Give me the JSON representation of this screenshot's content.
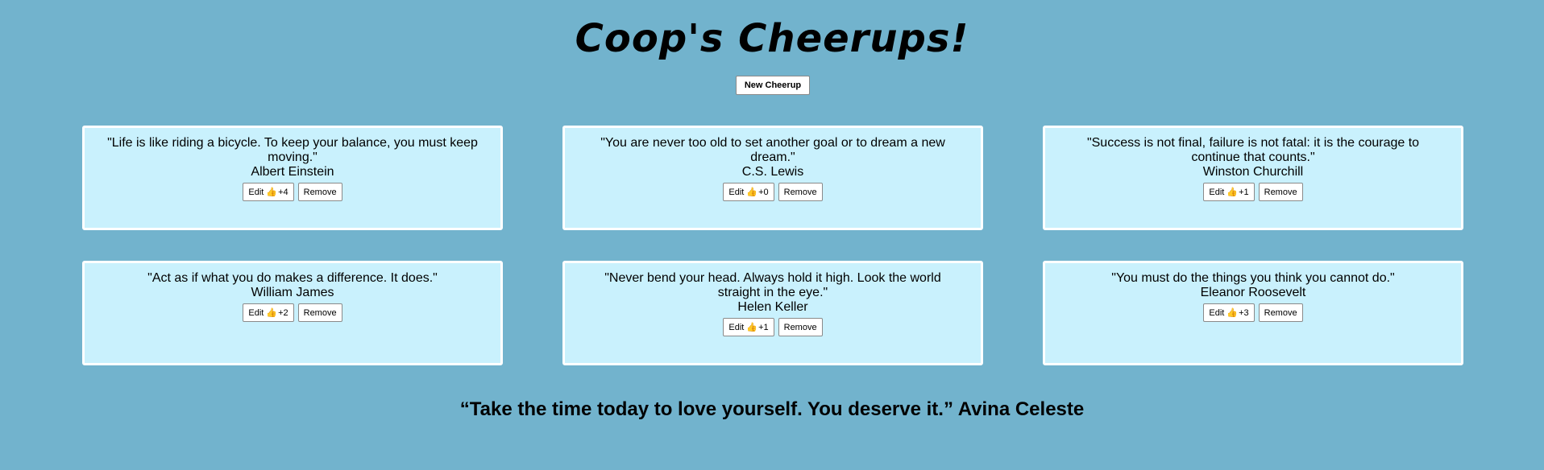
{
  "title": "Coop's Cheerups!",
  "new_button": "New Cheerup",
  "cards": [
    {
      "quote": "\"Life is like riding a bicycle. To keep your balance, you must keep moving.\"",
      "author": "Albert Einstein",
      "edit": "Edit",
      "thumb": "👍",
      "likes": "+4",
      "remove": "Remove"
    },
    {
      "quote": "\"You are never too old to set another goal or to dream a new dream.\"",
      "author": "C.S. Lewis",
      "edit": "Edit",
      "thumb": "👍",
      "likes": "+0",
      "remove": "Remove"
    },
    {
      "quote": "\"Success is not final, failure is not fatal: it is the courage to continue that counts.\"",
      "author": "Winston Churchill",
      "edit": "Edit",
      "thumb": "👍",
      "likes": "+1",
      "remove": "Remove"
    },
    {
      "quote": "\"Act as if what you do makes a difference. It does.\"",
      "author": "William James",
      "edit": "Edit",
      "thumb": "👍",
      "likes": "+2",
      "remove": "Remove"
    },
    {
      "quote": "\"Never bend your head. Always hold it high. Look the world straight in the eye.\"",
      "author": "Helen Keller",
      "edit": "Edit",
      "thumb": "👍",
      "likes": "+1",
      "remove": "Remove"
    },
    {
      "quote": "\"You must do the things you think you cannot do.\"",
      "author": "Eleanor Roosevelt",
      "edit": "Edit",
      "thumb": "👍",
      "likes": "+3",
      "remove": "Remove"
    }
  ],
  "footer_quote": "“Take the time today to love yourself. You deserve it.” Avina Celeste",
  "colors": {
    "background": "#72b3cd",
    "card": "#c9f1fd",
    "card_border": "#ffffff"
  }
}
